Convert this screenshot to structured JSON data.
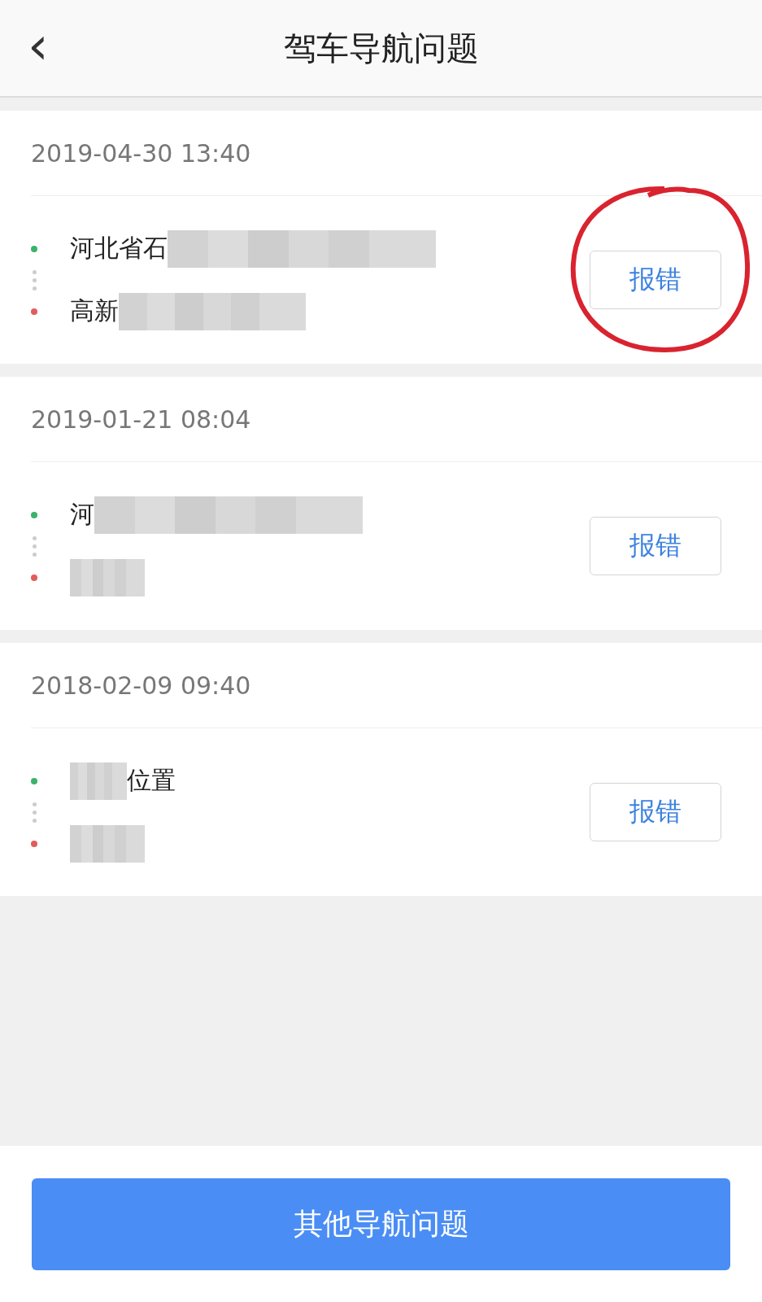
{
  "header": {
    "back_icon": "‹",
    "title": "驾车导航问题"
  },
  "records": [
    {
      "time": "2019-04-30 13:40",
      "start": {
        "text": "河北省石",
        "redacted_after": true
      },
      "end": {
        "text": "高新",
        "redacted_after": true
      },
      "button": "报错",
      "annotated": true
    },
    {
      "time": "2019-01-21 08:04",
      "start": {
        "text": "河",
        "redacted_after": true
      },
      "end": {
        "redacted_after": true
      },
      "button": "报错"
    },
    {
      "time": "2018-02-09 09:40",
      "start": {
        "text": "位置",
        "redacted_before": true
      },
      "end": {
        "redacted_after": true
      },
      "button": "报错"
    }
  ],
  "footer_button": "其他导航问题"
}
